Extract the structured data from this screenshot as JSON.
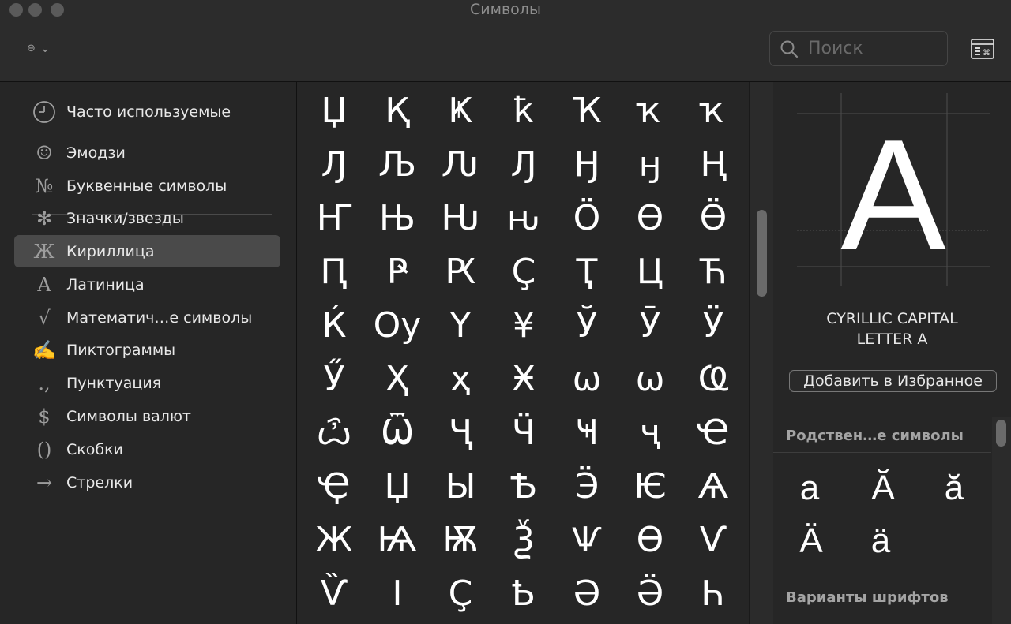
{
  "window": {
    "title": "Символы"
  },
  "toolbar": {
    "view_menu_icon": "view-options-icon",
    "search_placeholder": "Поиск",
    "keyboard_button_icon": "keyboard-viewer-icon"
  },
  "sidebar": {
    "items": [
      {
        "label": "Часто используемые",
        "icon": "🕘",
        "icon_name": "clock-icon",
        "selected": false
      },
      {
        "label": "Эмодзи",
        "icon": "☺",
        "icon_name": "smiley-icon",
        "selected": false
      },
      {
        "label": "Буквенные символы",
        "icon": "№",
        "icon_name": "numero-icon",
        "selected": false
      },
      {
        "label": "Значки/звезды",
        "icon": "✻",
        "icon_name": "asterisk-icon",
        "selected": false
      },
      {
        "label": "Кириллица",
        "icon": "Ж",
        "icon_name": "cyrillic-icon",
        "selected": true
      },
      {
        "label": "Латиница",
        "icon": "A",
        "icon_name": "latin-icon",
        "selected": false
      },
      {
        "label": "Математич…е символы",
        "icon": "√",
        "icon_name": "square-root-icon",
        "selected": false
      },
      {
        "label": "Пиктограммы",
        "icon": "✍",
        "icon_name": "writing-hand-icon",
        "selected": false
      },
      {
        "label": "Пунктуация",
        "icon": ".,",
        "icon_name": "punctuation-icon",
        "selected": false
      },
      {
        "label": "Символы валют",
        "icon": "$",
        "icon_name": "dollar-icon",
        "selected": false
      },
      {
        "label": "Скобки",
        "icon": "()",
        "icon_name": "parentheses-icon",
        "selected": false
      },
      {
        "label": "Стрелки",
        "icon": "→",
        "icon_name": "arrow-icon",
        "selected": false
      }
    ]
  },
  "grid": {
    "rows": [
      [
        "Џ",
        "Қ",
        "Ҝ",
        "ҟ",
        "Ҡ",
        "ҡ",
        "ҡ"
      ],
      [
        "Ԓ",
        "Љ",
        "Ԉ",
        "Ԓ",
        "Ӈ",
        "ӈ",
        "Ң"
      ],
      [
        "Ҥ",
        "Њ",
        "Ԋ",
        "ԋ",
        "Ö",
        "Ө",
        "Ӫ"
      ],
      [
        "Ԥ",
        "Ҏ",
        "Ԗ",
        "Ç",
        "Ҭ",
        "Ц",
        "Ћ"
      ],
      [
        "Ќ",
        "Оу",
        "Ү",
        "¥",
        "Ў",
        "Ӯ",
        "Ӱ"
      ],
      [
        "Ӳ",
        "Ҳ",
        "ҳ",
        "Ӿ",
        "ѡ",
        "ѡ",
        "Ҩ"
      ],
      [
        "ѽ",
        "Ѿ",
        "Ҷ",
        "Ӵ",
        "Ҹ",
        "ҷ",
        "Ҽ"
      ],
      [
        "Ҿ",
        "Џ",
        "Ы",
        "Ѣ",
        "Ӭ",
        "Ѥ",
        "Ѧ"
      ],
      [
        "Ж",
        "Ѩ",
        "Ѭ",
        "Ѯ",
        "Ѱ",
        "Ѳ",
        "Ѵ"
      ],
      [
        "Ѷ",
        "І",
        "Ҫ",
        "Ҍ",
        "Ә",
        "Ӛ",
        "Һ"
      ]
    ]
  },
  "detail": {
    "glyph": "A",
    "name_line1": "CYRILLIC CAPITAL",
    "name_line2": "LETTER A",
    "favorite_button": "Добавить в Избранное",
    "related_header": "Родствен…е символы",
    "related": [
      "a",
      "Ă",
      "ă",
      "Ä",
      "ä"
    ],
    "font_variants_header": "Варианты шрифтов"
  }
}
